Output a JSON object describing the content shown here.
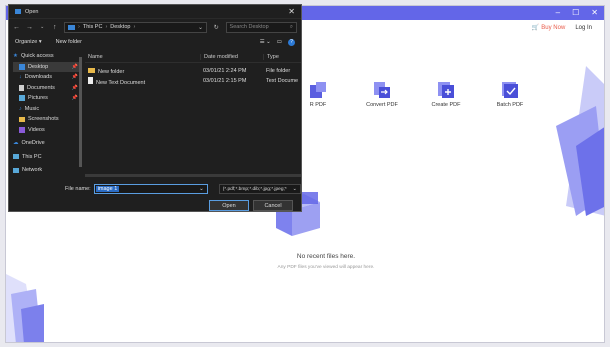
{
  "app": {
    "buy_now": "Buy Now",
    "login": "Log In",
    "tiles": [
      {
        "label": "R PDF",
        "icon": "edit-pdf-icon"
      },
      {
        "label": "Convert PDF",
        "icon": "convert-pdf-icon"
      },
      {
        "label": "Create PDF",
        "icon": "create-pdf-icon"
      },
      {
        "label": "Batch PDF",
        "icon": "batch-pdf-icon"
      }
    ],
    "empty_title": "No recent files here.",
    "empty_sub": "Any PDF files you've viewed will appear here.",
    "accent": "#6366e8"
  },
  "dialog": {
    "title": "Open",
    "path": [
      "This PC",
      "Desktop"
    ],
    "search_placeholder": "Search Desktop",
    "organize": "Organize ▾",
    "new_folder": "New folder",
    "nav": [
      {
        "label": "Quick access",
        "icon": "star-icon",
        "color": "#3a86d8",
        "indent": false
      },
      {
        "label": "Desktop",
        "icon": "desktop-icon",
        "color": "#3a86d8",
        "indent": true,
        "active": true,
        "pin": true
      },
      {
        "label": "Downloads",
        "icon": "download-icon",
        "color": "#3a86d8",
        "indent": true,
        "pin": true
      },
      {
        "label": "Documents",
        "icon": "documents-icon",
        "color": "#cfcfcf",
        "indent": true,
        "pin": true
      },
      {
        "label": "Pictures",
        "icon": "pictures-icon",
        "color": "#58a8d8",
        "indent": true,
        "pin": true
      },
      {
        "label": "Music",
        "icon": "music-icon",
        "color": "#3a86d8",
        "indent": true
      },
      {
        "label": "Screenshots",
        "icon": "folder-icon",
        "color": "#e8b94a",
        "indent": true
      },
      {
        "label": "Videos",
        "icon": "videos-icon",
        "color": "#8a5ad8",
        "indent": true
      },
      {
        "label": "OneDrive",
        "icon": "cloud-icon",
        "color": "#3a86d8",
        "indent": false
      },
      {
        "label": "This PC",
        "icon": "computer-icon",
        "color": "#58a8d8",
        "indent": false
      },
      {
        "label": "Network",
        "icon": "network-icon",
        "color": "#58a8d8",
        "indent": false
      }
    ],
    "columns": {
      "name": "Name",
      "date": "Date modified",
      "type": "Type"
    },
    "files": [
      {
        "name": "New folder",
        "date": "03/01/21 2:24 PM",
        "type": "File folder",
        "kind": "folder"
      },
      {
        "name": "New Text Document",
        "date": "03/01/21 2:15 PM",
        "type": "Text Docume",
        "kind": "file"
      }
    ],
    "file_name_label": "File name:",
    "file_name_value": "image 1",
    "filter": "(*.pdf;*.bmp;*.dib;*.jpg;*.jpeg;*",
    "open": "Open",
    "cancel": "Cancel"
  }
}
